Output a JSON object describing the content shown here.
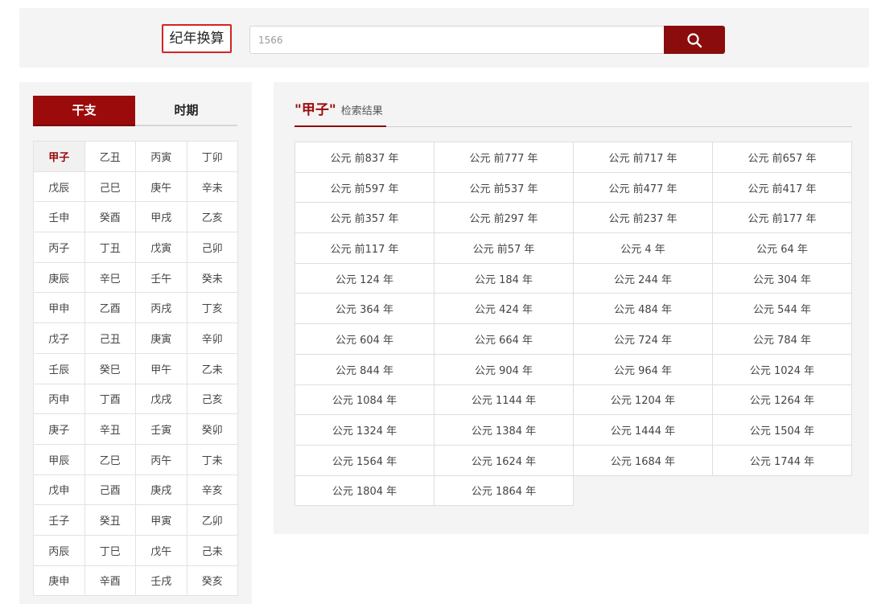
{
  "header": {
    "title": "纪年换算",
    "search_value": "1566",
    "search_icon": "search-icon",
    "accent": "#8b0c0c",
    "title_border": "#d42424"
  },
  "tabs": [
    {
      "label": "干支",
      "active": true
    },
    {
      "label": "时期",
      "active": false
    }
  ],
  "ganzhi": [
    [
      "甲子",
      "乙丑",
      "丙寅",
      "丁卯"
    ],
    [
      "戊辰",
      "己巳",
      "庚午",
      "辛未"
    ],
    [
      "壬申",
      "癸酉",
      "甲戌",
      "乙亥"
    ],
    [
      "丙子",
      "丁丑",
      "戊寅",
      "己卯"
    ],
    [
      "庚辰",
      "辛巳",
      "壬午",
      "癸未"
    ],
    [
      "甲申",
      "乙酉",
      "丙戌",
      "丁亥"
    ],
    [
      "戊子",
      "己丑",
      "庚寅",
      "辛卯"
    ],
    [
      "壬辰",
      "癸巳",
      "甲午",
      "乙未"
    ],
    [
      "丙申",
      "丁酉",
      "戊戌",
      "己亥"
    ],
    [
      "庚子",
      "辛丑",
      "壬寅",
      "癸卯"
    ],
    [
      "甲辰",
      "乙巳",
      "丙午",
      "丁未"
    ],
    [
      "戊申",
      "己酉",
      "庚戌",
      "辛亥"
    ],
    [
      "壬子",
      "癸丑",
      "甲寅",
      "乙卯"
    ],
    [
      "丙辰",
      "丁巳",
      "戊午",
      "己未"
    ],
    [
      "庚申",
      "辛酉",
      "壬戌",
      "癸亥"
    ]
  ],
  "selected_ganzhi": "甲子",
  "result": {
    "term": "\"甲子\"",
    "label": "检索结果",
    "years": [
      [
        "公元 前837 年",
        "公元 前777 年",
        "公元 前717 年",
        "公元 前657 年"
      ],
      [
        "公元 前597 年",
        "公元 前537 年",
        "公元 前477 年",
        "公元 前417 年"
      ],
      [
        "公元 前357 年",
        "公元 前297 年",
        "公元 前237 年",
        "公元 前177 年"
      ],
      [
        "公元 前117 年",
        "公元 前57 年",
        "公元 4 年",
        "公元 64 年"
      ],
      [
        "公元 124 年",
        "公元 184 年",
        "公元 244 年",
        "公元 304 年"
      ],
      [
        "公元 364 年",
        "公元 424 年",
        "公元 484 年",
        "公元 544 年"
      ],
      [
        "公元 604 年",
        "公元 664 年",
        "公元 724 年",
        "公元 784 年"
      ],
      [
        "公元 844 年",
        "公元 904 年",
        "公元 964 年",
        "公元 1024 年"
      ],
      [
        "公元 1084 年",
        "公元 1144 年",
        "公元 1204 年",
        "公元 1264 年"
      ],
      [
        "公元 1324 年",
        "公元 1384 年",
        "公元 1444 年",
        "公元 1504 年"
      ],
      [
        "公元 1564 年",
        "公元 1624 年",
        "公元 1684 年",
        "公元 1744 年"
      ],
      [
        "公元 1804 年",
        "公元 1864 年"
      ]
    ]
  }
}
